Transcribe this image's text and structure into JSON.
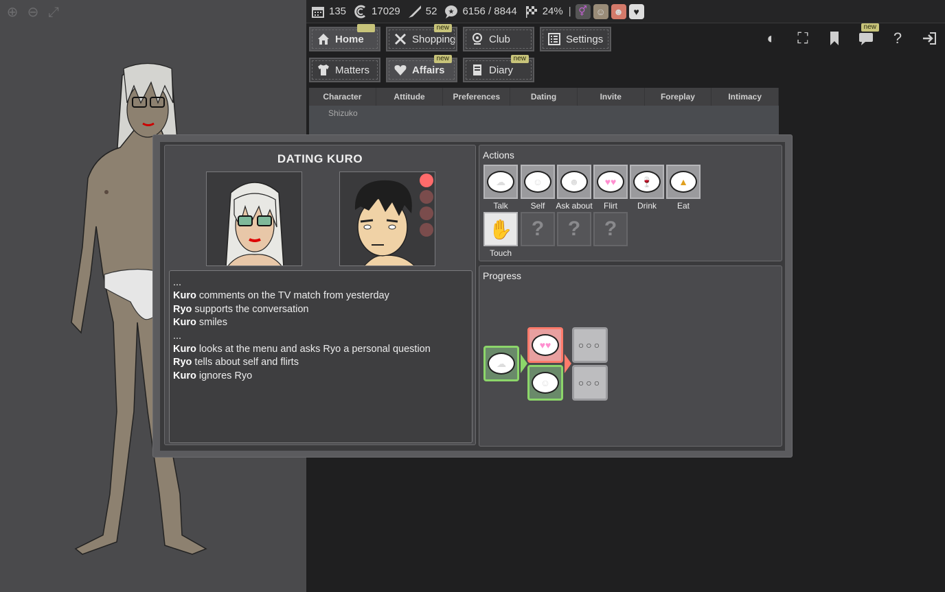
{
  "topbar": {
    "day": "135",
    "money": "17029",
    "stamina": "52",
    "reputation": "6156 / 8844",
    "progress": "24%",
    "divider": "|"
  },
  "nav": {
    "home": "Home",
    "shopping": "Shopping",
    "club": "Club",
    "settings": "Settings",
    "matters": "Matters",
    "affairs": "Affairs",
    "diary": "Diary",
    "new_badge": "new"
  },
  "table": {
    "columns": [
      "Character",
      "Attitude",
      "Preferences",
      "Dating",
      "Invite",
      "Foreplay",
      "Intimacy"
    ],
    "row_name": "Shizuko"
  },
  "dating": {
    "title": "DATING KURO",
    "log": [
      {
        "who": "",
        "text": "..."
      },
      {
        "who": "Kuro",
        "text": " comments on the TV match from yesterday"
      },
      {
        "who": "Ryo",
        "text": " supports the conversation"
      },
      {
        "who": "Kuro",
        "text": " smiles"
      },
      {
        "who": "",
        "text": "..."
      },
      {
        "who": "Kuro",
        "text": " looks at the menu and asks Ryo a personal question"
      },
      {
        "who": "Ryo",
        "text": " tells about self and flirts"
      },
      {
        "who": "Kuro",
        "text": " ignores Ryo"
      }
    ]
  },
  "actions": {
    "title": "Actions",
    "items": [
      "Talk",
      "Self",
      "Ask about",
      "Flirt",
      "Drink",
      "Eat",
      "Touch"
    ],
    "locked_symbol": "?"
  },
  "progress": {
    "title": "Progress",
    "pending": "○○○"
  },
  "colors": {
    "accent_green": "#8cd66a",
    "accent_red": "#ff6b6b",
    "badge": "#c8c47a"
  }
}
